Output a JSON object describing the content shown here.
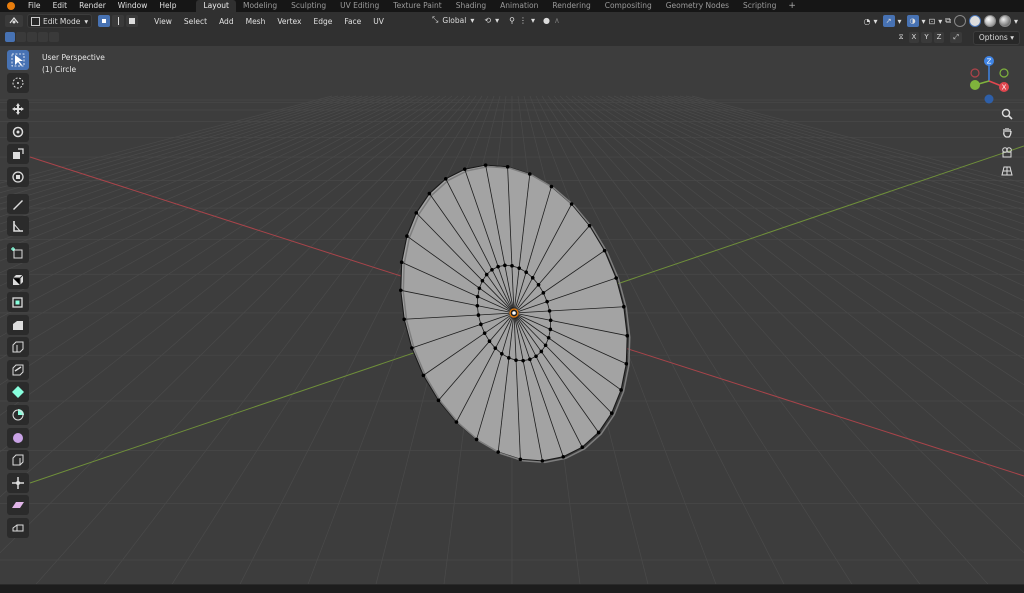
{
  "app": {
    "menu": [
      "File",
      "Edit",
      "Render",
      "Window",
      "Help"
    ],
    "workspaces": [
      "Layout",
      "Modeling",
      "Sculpting",
      "UV Editing",
      "Texture Paint",
      "Shading",
      "Animation",
      "Rendering",
      "Compositing",
      "Geometry Nodes",
      "Scripting"
    ],
    "active_workspace": "Layout",
    "add_tab": "+"
  },
  "header": {
    "mode": "Edit Mode",
    "menu": [
      "View",
      "Select",
      "Add",
      "Mesh",
      "Vertex",
      "Edge",
      "Face",
      "UV"
    ],
    "orientation": "Global"
  },
  "subheader": {
    "axes": [
      "X",
      "Y",
      "Z"
    ],
    "options": "Options"
  },
  "viewport": {
    "perspective": "User Perspective",
    "object": "(1) Circle"
  },
  "gizmo": {
    "x": "X",
    "y": "Y",
    "z": "Z"
  },
  "toolbar": {
    "tools": [
      "select-box",
      "cursor",
      "move",
      "rotate",
      "scale",
      "transform",
      "annotate",
      "measure",
      "add-cube",
      "extrude-region",
      "inset-faces",
      "bevel",
      "loop-cut",
      "knife",
      "poly-build",
      "spin",
      "smooth",
      "edge-slide",
      "shrink-fatten",
      "shear",
      "rip-region"
    ],
    "active": "select-box"
  },
  "colors": {
    "accent": "#4772b3",
    "x_axis": "#e0464e",
    "y_axis": "#7fb33c",
    "z_axis": "#3f84e5",
    "mesh_face": "#a3a3a3",
    "viewport_bg": "#3d3d3d"
  }
}
